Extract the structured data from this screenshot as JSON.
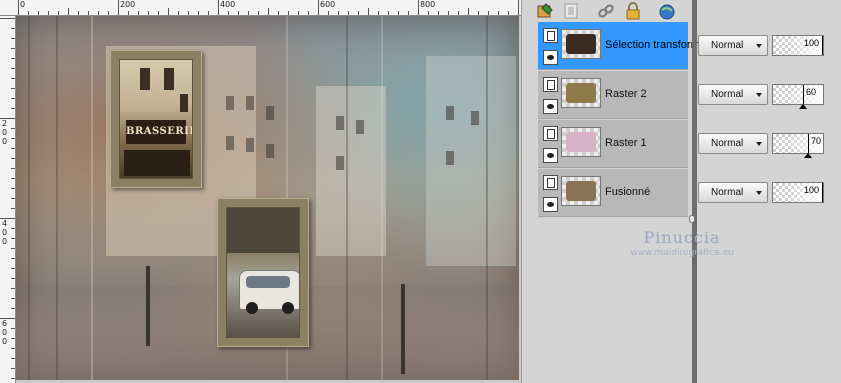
{
  "ruler": {
    "top_labels": [
      "0",
      "200",
      "400",
      "600",
      "800"
    ],
    "left_labels": [
      "2",
      "0",
      "0",
      "4",
      "0",
      "0",
      "6",
      "0",
      "0"
    ]
  },
  "canvas": {
    "sign_text": "BRASSERIE"
  },
  "toolbar": {
    "icons": [
      "layer-properties-icon",
      "mask-icon",
      "link-icon",
      "lock-icon",
      "globe-icon"
    ]
  },
  "layers": [
    {
      "name": "Sélection transformée",
      "blend_mode": "Normal",
      "opacity": "100",
      "opacity_fraction": 1.0,
      "selected": true,
      "thumb_color": "#3b2b20"
    },
    {
      "name": "Raster 2",
      "blend_mode": "Normal",
      "opacity": "60",
      "opacity_fraction": 0.6,
      "selected": false,
      "thumb_color": "#8f7b4a"
    },
    {
      "name": "Raster 1",
      "blend_mode": "Normal",
      "opacity": "70",
      "opacity_fraction": 0.7,
      "selected": false,
      "thumb_color": "#d6b2c4"
    },
    {
      "name": "Fusionné",
      "blend_mode": "Normal",
      "opacity": "100",
      "opacity_fraction": 1.0,
      "selected": false,
      "thumb_color": "#8a7355"
    }
  ],
  "watermark": {
    "name": "Pinuccia",
    "url": "www.maidiregrafica.eu"
  },
  "colors": {
    "selection": "#3399ff",
    "frame": "#8c8064"
  }
}
